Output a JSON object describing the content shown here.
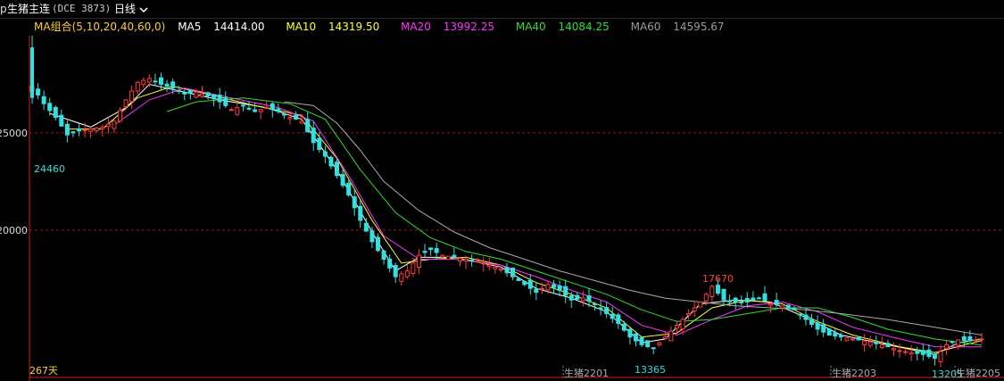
{
  "top_bar": {
    "prefix": "p",
    "instrument": "生猪主连",
    "exchange_code": "(DCE 3873)",
    "period": "日线"
  },
  "ma_legend": {
    "group_label": "MA组合(5,10,20,40,60,0)",
    "items": [
      {
        "label": "MA5",
        "value": "14414.00",
        "color": "#ffffff"
      },
      {
        "label": "MA10",
        "value": "14319.50",
        "color": "#ffff33"
      },
      {
        "label": "MA20",
        "value": "13992.25",
        "color": "#ff33ff"
      },
      {
        "label": "MA40",
        "value": "14084.25",
        "color": "#33dd33"
      },
      {
        "label": "MA60",
        "value": "14595.67",
        "color": "#999999"
      }
    ]
  },
  "labels": {
    "days": "267天",
    "contract_markers": [
      "生猪2201",
      "生猪2203",
      "生猪2205"
    ]
  },
  "chart_data": {
    "type": "candlestick",
    "y_tick_labels": [
      "25000",
      "20000"
    ],
    "y_ticks": [
      25000,
      20000
    ],
    "ylim": [
      12420,
      30000
    ],
    "extremes": {
      "high": {
        "value": "17670",
        "color": "#ff4444"
      },
      "low_1": {
        "value": "24460",
        "color": "#33dddd"
      },
      "low_2": {
        "value": "13365",
        "color": "#33dddd"
      },
      "low_3": {
        "value": "13205",
        "color": "#33dddd"
      }
    },
    "close_path": [
      [
        0,
        27400
      ],
      [
        2,
        26500
      ],
      [
        4,
        25800
      ],
      [
        6,
        24900
      ],
      [
        8,
        25100
      ],
      [
        10,
        25200
      ],
      [
        12,
        25300
      ],
      [
        14,
        25600
      ],
      [
        16,
        26700
      ],
      [
        18,
        27600
      ],
      [
        20,
        27800
      ],
      [
        22,
        27500
      ],
      [
        24,
        27300
      ],
      [
        26,
        27000
      ],
      [
        28,
        27100
      ],
      [
        30,
        26900
      ],
      [
        32,
        26600
      ],
      [
        34,
        26200
      ],
      [
        36,
        26400
      ],
      [
        38,
        26100
      ],
      [
        40,
        26300
      ],
      [
        42,
        26100
      ],
      [
        44,
        25800
      ],
      [
        46,
        25600
      ],
      [
        48,
        24500
      ],
      [
        50,
        23800
      ],
      [
        52,
        22800
      ],
      [
        54,
        21800
      ],
      [
        56,
        20500
      ],
      [
        58,
        19400
      ],
      [
        60,
        18500
      ],
      [
        62,
        17600
      ],
      [
        64,
        17900
      ],
      [
        66,
        18700
      ],
      [
        68,
        19000
      ],
      [
        70,
        18700
      ],
      [
        72,
        18600
      ],
      [
        74,
        18500
      ],
      [
        76,
        18400
      ],
      [
        78,
        18200
      ],
      [
        80,
        18000
      ],
      [
        82,
        17600
      ],
      [
        84,
        17200
      ],
      [
        86,
        16800
      ],
      [
        88,
        17200
      ],
      [
        90,
        16900
      ],
      [
        92,
        16400
      ],
      [
        94,
        16500
      ],
      [
        96,
        16200
      ],
      [
        98,
        15700
      ],
      [
        100,
        15200
      ],
      [
        102,
        14500
      ],
      [
        104,
        14100
      ],
      [
        106,
        13900
      ],
      [
        108,
        14500
      ],
      [
        110,
        15100
      ],
      [
        112,
        15700
      ],
      [
        114,
        16300
      ],
      [
        116,
        17100
      ],
      [
        118,
        16400
      ],
      [
        120,
        16300
      ],
      [
        122,
        16300
      ],
      [
        124,
        16500
      ],
      [
        126,
        16200
      ],
      [
        128,
        16100
      ],
      [
        130,
        15900
      ],
      [
        132,
        15400
      ],
      [
        134,
        14900
      ],
      [
        136,
        14600
      ],
      [
        138,
        14500
      ],
      [
        140,
        14400
      ],
      [
        142,
        14300
      ],
      [
        144,
        14200
      ],
      [
        146,
        14000
      ],
      [
        148,
        13800
      ],
      [
        150,
        13700
      ],
      [
        152,
        13600
      ],
      [
        154,
        13400
      ],
      [
        156,
        14100
      ],
      [
        158,
        14350
      ],
      [
        160,
        14300
      ],
      [
        162,
        14400
      ]
    ],
    "ma_lines": [
      {
        "name": "MA5",
        "color": "#ffffff",
        "path": [
          [
            3,
            26000
          ],
          [
            10,
            25300
          ],
          [
            16,
            26300
          ],
          [
            20,
            27500
          ],
          [
            26,
            27100
          ],
          [
            32,
            26700
          ],
          [
            40,
            26300
          ],
          [
            46,
            25700
          ],
          [
            52,
            23100
          ],
          [
            58,
            19900
          ],
          [
            62,
            17900
          ],
          [
            66,
            18600
          ],
          [
            72,
            18600
          ],
          [
            80,
            18100
          ],
          [
            86,
            17000
          ],
          [
            92,
            16500
          ],
          [
            98,
            15800
          ],
          [
            104,
            14200
          ],
          [
            108,
            14400
          ],
          [
            114,
            16200
          ],
          [
            120,
            16400
          ],
          [
            126,
            16300
          ],
          [
            132,
            15500
          ],
          [
            138,
            14600
          ],
          [
            146,
            14100
          ],
          [
            154,
            13600
          ],
          [
            158,
            14200
          ],
          [
            162,
            14410
          ]
        ]
      },
      {
        "name": "MA10",
        "color": "#ffff33",
        "path": [
          [
            6,
            25200
          ],
          [
            12,
            25200
          ],
          [
            18,
            26800
          ],
          [
            24,
            27400
          ],
          [
            30,
            27000
          ],
          [
            38,
            26400
          ],
          [
            46,
            25900
          ],
          [
            52,
            23700
          ],
          [
            58,
            20500
          ],
          [
            63,
            18300
          ],
          [
            68,
            18500
          ],
          [
            74,
            18600
          ],
          [
            80,
            18200
          ],
          [
            86,
            17300
          ],
          [
            92,
            16700
          ],
          [
            98,
            16000
          ],
          [
            104,
            14500
          ],
          [
            110,
            14700
          ],
          [
            116,
            16000
          ],
          [
            122,
            16400
          ],
          [
            128,
            16200
          ],
          [
            134,
            15300
          ],
          [
            140,
            14600
          ],
          [
            148,
            14000
          ],
          [
            154,
            13700
          ],
          [
            162,
            14320
          ]
        ]
      },
      {
        "name": "MA20",
        "color": "#ff33ff",
        "path": [
          [
            14,
            25400
          ],
          [
            20,
            26700
          ],
          [
            26,
            27300
          ],
          [
            34,
            26800
          ],
          [
            42,
            26300
          ],
          [
            48,
            25600
          ],
          [
            54,
            22800
          ],
          [
            60,
            19700
          ],
          [
            66,
            18500
          ],
          [
            72,
            18500
          ],
          [
            80,
            18200
          ],
          [
            86,
            17600
          ],
          [
            92,
            16900
          ],
          [
            98,
            16300
          ],
          [
            104,
            15100
          ],
          [
            110,
            14600
          ],
          [
            116,
            15400
          ],
          [
            122,
            16100
          ],
          [
            128,
            16300
          ],
          [
            134,
            15800
          ],
          [
            140,
            15000
          ],
          [
            148,
            14400
          ],
          [
            154,
            14000
          ],
          [
            162,
            13990
          ]
        ]
      },
      {
        "name": "MA40",
        "color": "#33dd33",
        "path": [
          [
            23,
            26100
          ],
          [
            28,
            26600
          ],
          [
            36,
            26800
          ],
          [
            44,
            26500
          ],
          [
            50,
            25700
          ],
          [
            56,
            23100
          ],
          [
            62,
            20900
          ],
          [
            68,
            19600
          ],
          [
            74,
            18900
          ],
          [
            80,
            18500
          ],
          [
            86,
            17900
          ],
          [
            92,
            17300
          ],
          [
            98,
            16700
          ],
          [
            104,
            15900
          ],
          [
            110,
            15300
          ],
          [
            116,
            15400
          ],
          [
            122,
            15700
          ],
          [
            128,
            16000
          ],
          [
            134,
            16000
          ],
          [
            140,
            15500
          ],
          [
            146,
            14900
          ],
          [
            154,
            14400
          ],
          [
            162,
            14080
          ]
        ]
      },
      {
        "name": "MA60",
        "color": "#aaaaaa",
        "path": [
          [
            43,
            26600
          ],
          [
            48,
            26400
          ],
          [
            52,
            25500
          ],
          [
            56,
            24100
          ],
          [
            60,
            22500
          ],
          [
            66,
            21000
          ],
          [
            72,
            19900
          ],
          [
            78,
            19100
          ],
          [
            84,
            18500
          ],
          [
            90,
            17900
          ],
          [
            96,
            17400
          ],
          [
            102,
            16900
          ],
          [
            108,
            16500
          ],
          [
            114,
            16300
          ],
          [
            120,
            16100
          ],
          [
            126,
            16000
          ],
          [
            132,
            15900
          ],
          [
            138,
            15700
          ],
          [
            146,
            15400
          ],
          [
            154,
            15000
          ],
          [
            162,
            14600
          ]
        ]
      }
    ]
  }
}
